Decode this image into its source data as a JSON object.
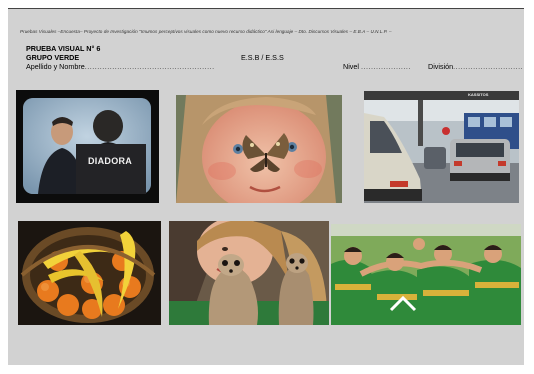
{
  "header": {
    "caption": "Pruebas Visuales –Encuesta– Proyecto de Investigación \"Imumos perceptivos visuales como nuevo recurso didáctico\" Asi lenguaje – Dto. Discursos Visuales – E.B.A – U.N.L.P. –",
    "test_title": "PRUEBA VISUAL   N° 6",
    "group": "GRUPO VERDE",
    "schools": "E.S.B  /  E.S.S",
    "name_label": "Apellido y Nombre",
    "name_dots": "....................................................",
    "level_label": "Nivel",
    "level_dots": "....................",
    "division_label": "División",
    "division_dots": "............................"
  },
  "photos": {
    "tv_banner": "DIADORA",
    "booth_sign": "KASSITOS"
  },
  "colors": {
    "sheet_bg": "#d2d2d2",
    "rugby_green": "#2f8a3a",
    "rugby_gold": "#d8b23a"
  }
}
